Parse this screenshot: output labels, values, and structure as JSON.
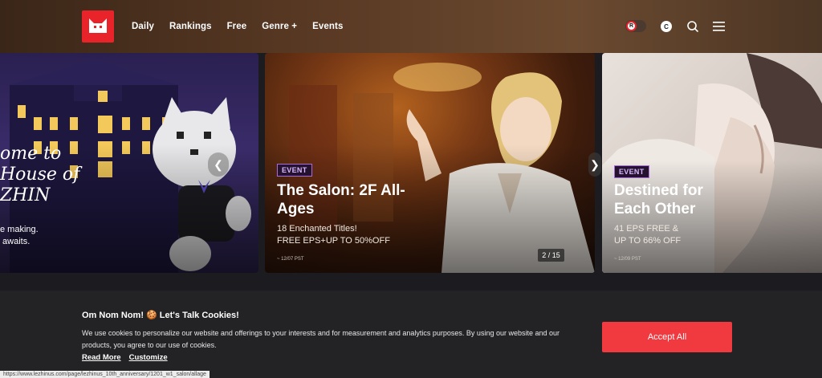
{
  "header": {
    "nav": [
      "Daily",
      "Rankings",
      "Free",
      "Genre +",
      "Events"
    ],
    "toggle_letter": "R",
    "coin_letter": "C"
  },
  "carousel": {
    "cards": [
      {
        "title_fragment": "ome to\nHouse of\nZHIN",
        "sub": "e making.\n awaits."
      },
      {
        "badge": "EVENT",
        "title": "The Salon: 2F All-Ages",
        "sub1": "18 Enchanted Titles!",
        "sub2": "FREE EPS+UP TO 50%OFF",
        "date": "~ 12/07 PST"
      },
      {
        "badge": "EVENT",
        "title": "Destined for Each Other",
        "sub1": "41 EPS FREE &",
        "sub2": "UP TO 66% OFF",
        "date": "~ 12/09 PST"
      }
    ],
    "counter": "2 / 15",
    "prev_arrow": "❮",
    "next_arrow": "❯"
  },
  "cookie": {
    "title": "Om Nom Nom! 🍪 Let's Talk Cookies!",
    "text": "We use cookies to personalize our website and offerings to your interests and for measurement and analytics purposes. By using our website and our products, you agree to our use of cookies.",
    "read_more": "Read More",
    "customize": "Customize",
    "accept": "Accept All"
  },
  "status_url": "https://www.lezhinus.com/page/lezhinus_10th_anniversary/1201_w1_salon/allage",
  "colors": {
    "brand": "#e8232a",
    "accept": "#f03a3f",
    "badge": "#a66cd9"
  }
}
